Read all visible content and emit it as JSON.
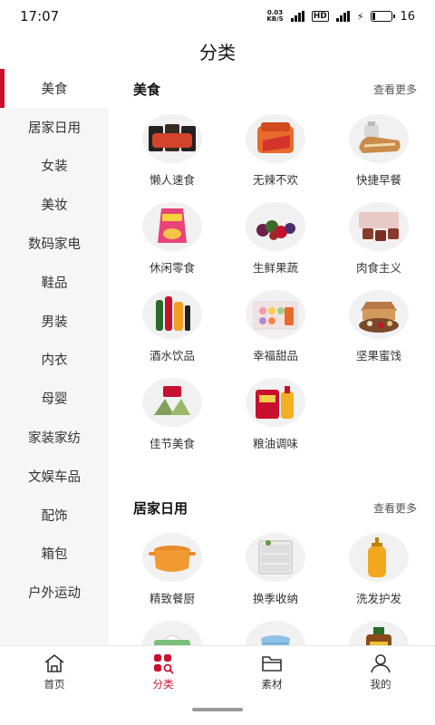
{
  "status": {
    "time": "17:07",
    "net_speed_value": "0.03",
    "net_speed_unit": "KB/S",
    "battery": "16"
  },
  "page": {
    "title": "分类"
  },
  "sidebar": {
    "items": [
      {
        "label": "美食",
        "active": true
      },
      {
        "label": "居家日用"
      },
      {
        "label": "女装"
      },
      {
        "label": "美妆"
      },
      {
        "label": "数码家电"
      },
      {
        "label": "鞋品"
      },
      {
        "label": "男装"
      },
      {
        "label": "内衣"
      },
      {
        "label": "母婴"
      },
      {
        "label": "家装家纺"
      },
      {
        "label": "文娱车品"
      },
      {
        "label": "配饰"
      },
      {
        "label": "箱包"
      },
      {
        "label": "户外运动"
      }
    ]
  },
  "sections": [
    {
      "title": "美食",
      "more": "查看更多",
      "items": [
        "懒人速食",
        "无辣不欢",
        "快捷早餐",
        "休闲零食",
        "生鲜果蔬",
        "肉食主义",
        "酒水饮品",
        "幸福甜品",
        "坚果蜜饯",
        "佳节美食",
        "粮油调味"
      ]
    },
    {
      "title": "居家日用",
      "more": "查看更多",
      "items": [
        "精致餐厨",
        "换季收纳",
        "洗发护发",
        "",
        "",
        ""
      ]
    }
  ],
  "tabbar": {
    "tabs": [
      {
        "label": "首页",
        "icon": "home-icon"
      },
      {
        "label": "分类",
        "icon": "category-icon",
        "active": true
      },
      {
        "label": "素材",
        "icon": "folder-icon"
      },
      {
        "label": "我的",
        "icon": "user-icon"
      }
    ]
  },
  "colors": {
    "accent": "#c8102e",
    "sidebar_bg": "#f6f6f6"
  }
}
